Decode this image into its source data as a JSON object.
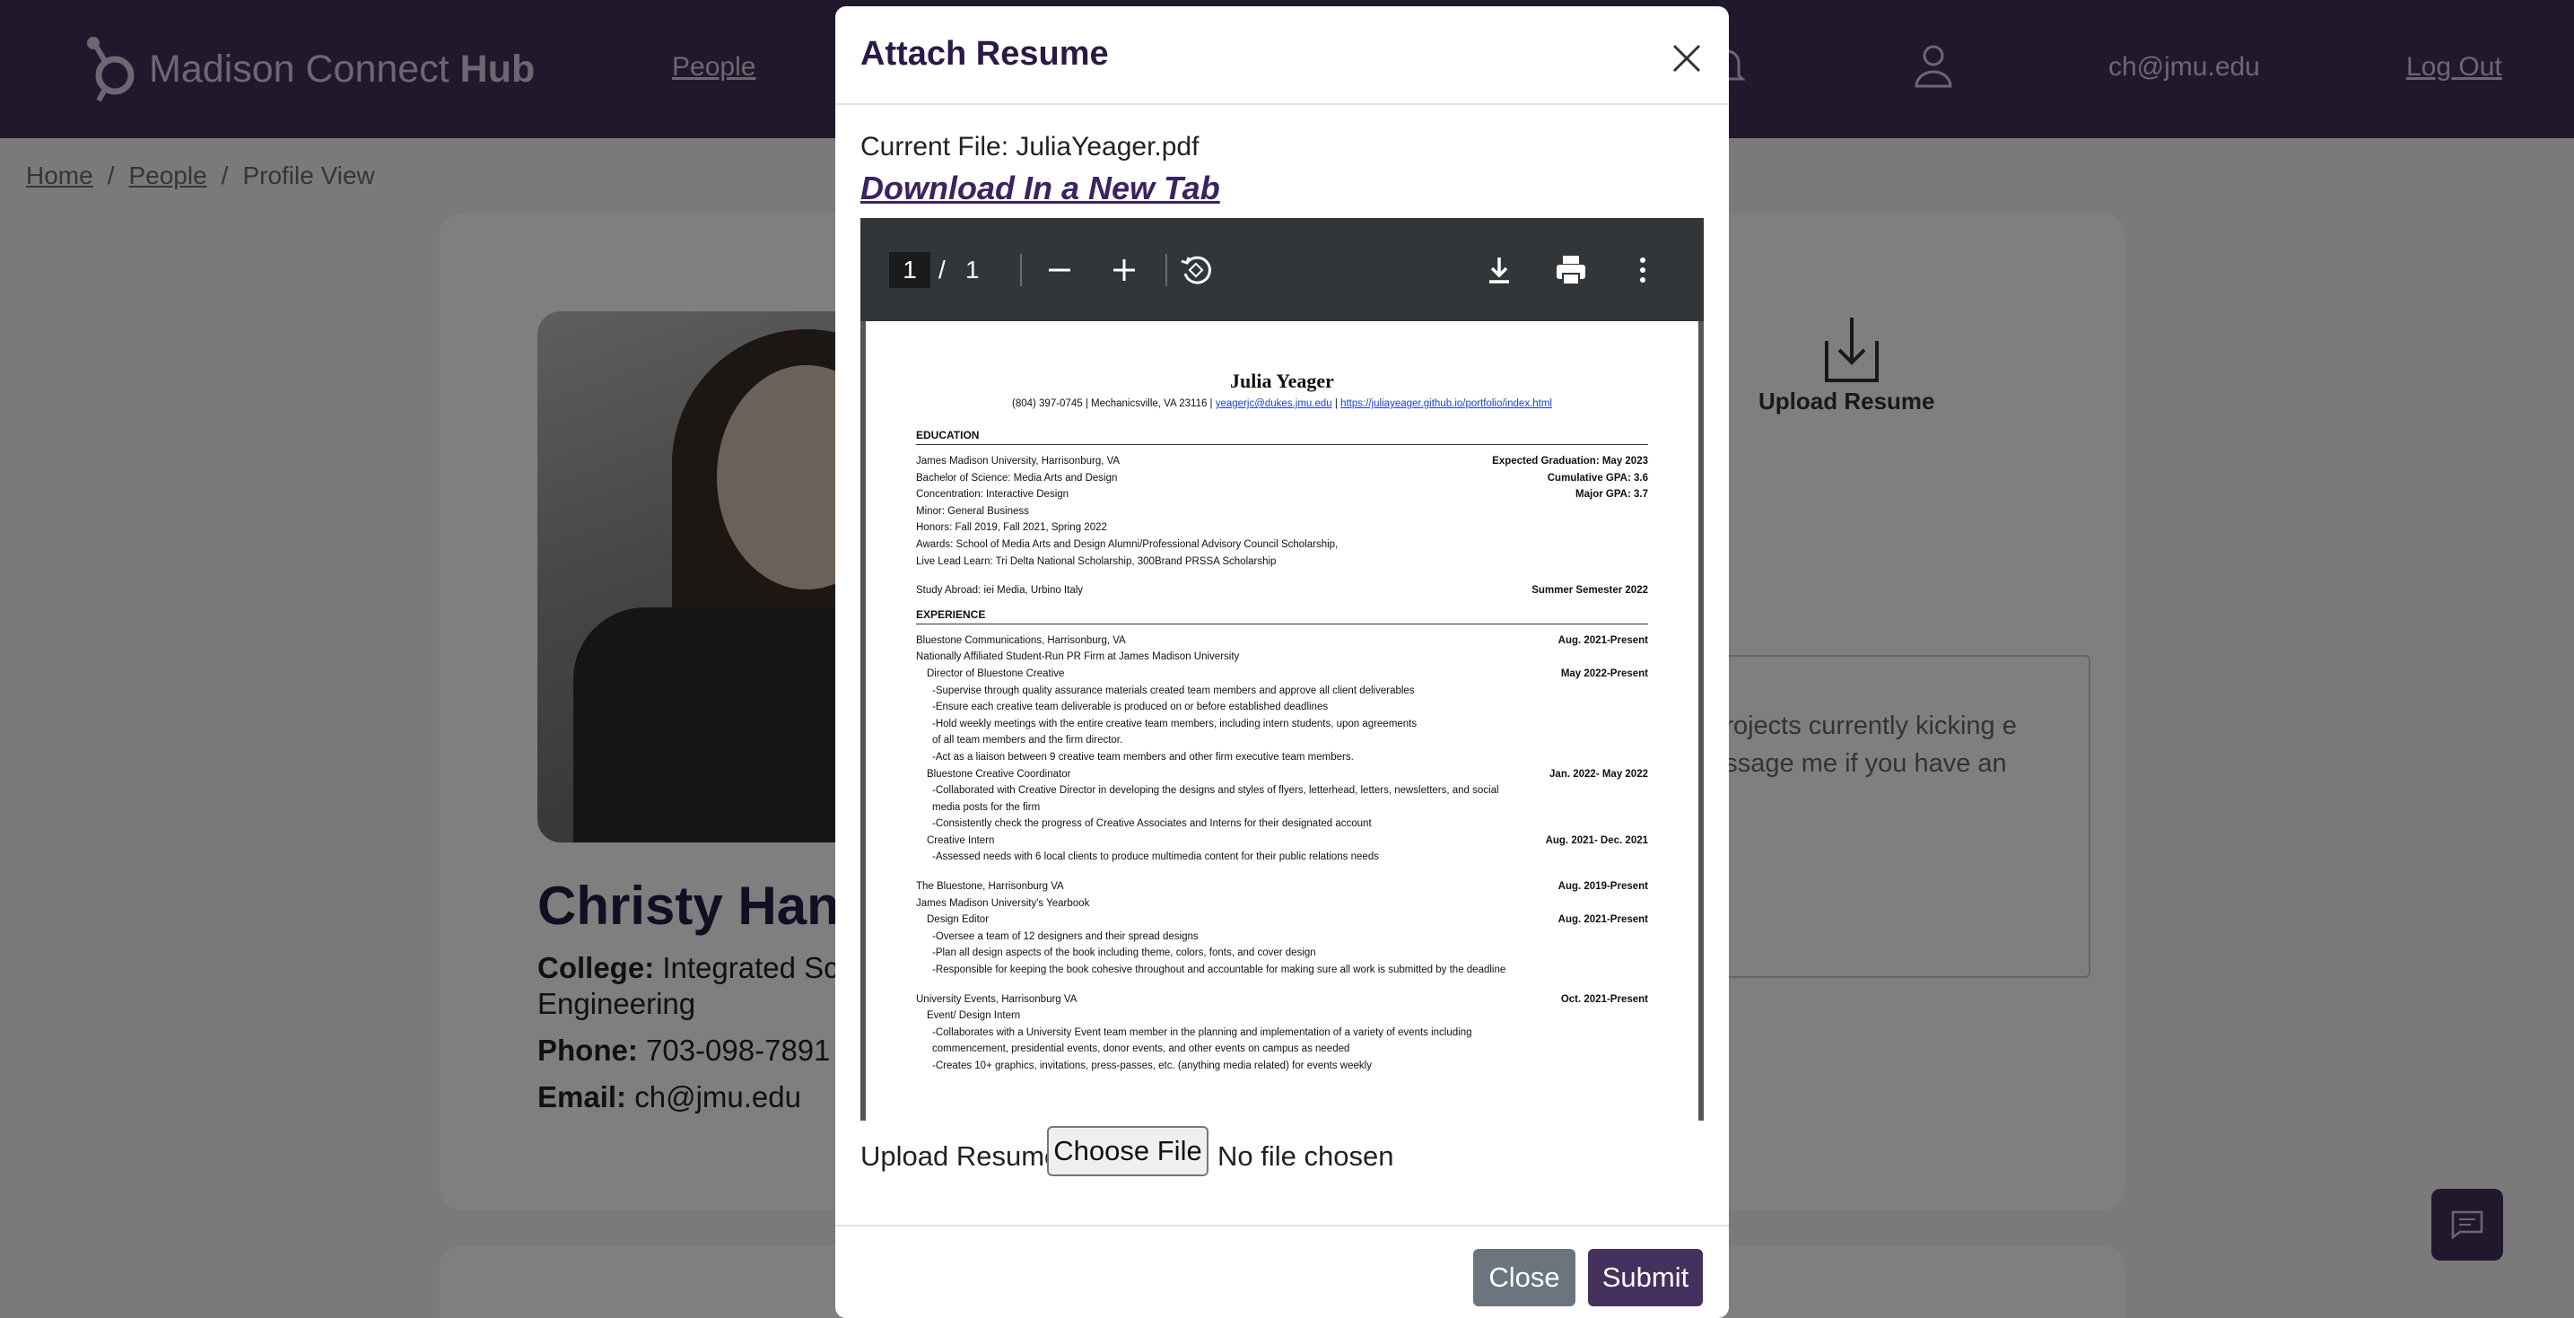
{
  "navbar": {
    "brand_light": "Madison Connect",
    "brand_bold": "Hub",
    "people_link": "People",
    "email": "ch@jmu.edu",
    "logout": "Log Out"
  },
  "breadcrumb": {
    "home": "Home",
    "sep1": "/",
    "people": "People",
    "sep2": "/",
    "current": "Profile View"
  },
  "profile": {
    "name": "Christy Hans",
    "college_label": "College:",
    "college_value": "Integrated Sci",
    "college_value_2": "Engineering",
    "phone_label": "Phone:",
    "phone_value": "703-098-7891",
    "email_label": "Email:",
    "email_value": "ch@jmu.edu"
  },
  "upload_card": {
    "label": "Upload Resume"
  },
  "bio": {
    "text": "e projects currently kicking e message me if you have an"
  },
  "modal": {
    "title": "Attach Resume",
    "current_file": "Current File: JuliaYeager.pdf",
    "download_link": "Download In a New Tab",
    "upload_label": "Upload Resume",
    "choose_file": "Choose File",
    "no_file": "No file chosen",
    "close_button": "Close",
    "submit_button": "Submit"
  },
  "pdf": {
    "current_page": "1",
    "separator": "/",
    "total_pages": "1",
    "resume": {
      "name": "Julia Yeager",
      "contact_prefix": "(804) 397-0745 | Mechanicsville, VA 23116 |",
      "contact_email": "yeagerjc@dukes.jmu.edu",
      "contact_sep": "|",
      "contact_url": "https://juliayeager.github.io/portfolio/index.html",
      "education_heading": "EDUCATION",
      "education_rows": [
        {
          "left": "James Madison University, Harrisonburg, VA",
          "right": "Expected Graduation: May 2023"
        },
        {
          "left": "Bachelor of Science: Media Arts and Design",
          "right": "Cumulative GPA: 3.6"
        },
        {
          "left": "Concentration: Interactive Design",
          "right": "Major GPA: 3.7"
        },
        {
          "left": "Minor: General Business",
          "right": ""
        },
        {
          "left": "Honors: Fall 2019, Fall 2021, Spring 2022",
          "right": ""
        },
        {
          "left": "Awards: School of Media Arts and Design Alumni/Professional Advisory Council Scholarship,",
          "right": ""
        },
        {
          "left": "Live Lead Learn: Tri Delta National Scholarship, 300Brand PRSSA Scholarship",
          "right": ""
        }
      ],
      "study_abroad": {
        "left": "Study Abroad: iei Media, Urbino Italy",
        "right": "Summer Semester 2022"
      },
      "experience_heading": "EXPERIENCE",
      "experience_rows": [
        {
          "left": "Bluestone Communications, Harrisonburg, VA",
          "right": "Aug. 2021-Present",
          "ind": 0
        },
        {
          "left": "Nationally Affiliated Student-Run PR Firm at James Madison University",
          "right": "",
          "ind": 0
        },
        {
          "left": "Director of Bluestone Creative",
          "right": "May 2022-Present",
          "ind": 1
        },
        {
          "left": "-Supervise through quality assurance materials created team members and approve all client deliverables",
          "right": "",
          "ind": 2
        },
        {
          "left": "-Ensure each creative team deliverable is produced on or before established deadlines",
          "right": "",
          "ind": 2
        },
        {
          "left": "-Hold weekly meetings with the entire creative team members, including intern students, upon agreements",
          "right": "",
          "ind": 2
        },
        {
          "left": "of all team members and the firm director.",
          "right": "",
          "ind": 2
        },
        {
          "left": "-Act as a liaison between 9 creative team members and other firm executive team members.",
          "right": "",
          "ind": 2
        },
        {
          "left": "Bluestone Creative Coordinator",
          "right": "Jan. 2022- May 2022",
          "ind": 1
        },
        {
          "left": "-Collaborated with Creative Director in developing the designs and styles of flyers, letterhead, letters, newsletters, and social",
          "right": "",
          "ind": 2
        },
        {
          "left": "media posts for the firm",
          "right": "",
          "ind": 2
        },
        {
          "left": "-Consistently check the progress of Creative Associates and Interns for their designated account",
          "right": "",
          "ind": 2
        },
        {
          "left": "Creative Intern",
          "right": "Aug. 2021- Dec. 2021",
          "ind": 1
        },
        {
          "left": "-Assessed needs with 6 local clients to produce multimedia content for their public relations needs",
          "right": "",
          "ind": 2
        },
        {
          "left": "",
          "right": "",
          "ind": 0
        },
        {
          "left": "The Bluestone, Harrisonburg VA",
          "right": "Aug. 2019-Present",
          "ind": 0
        },
        {
          "left": "James Madison University's Yearbook",
          "right": "",
          "ind": 0
        },
        {
          "left": "Design Editor",
          "right": "Aug. 2021-Present",
          "ind": 1
        },
        {
          "left": "-Oversee a team of 12 designers and their spread designs",
          "right": "",
          "ind": 2
        },
        {
          "left": "-Plan all design aspects of the book including theme, colors, fonts, and cover design",
          "right": "",
          "ind": 2
        },
        {
          "left": "-Responsible for keeping the book cohesive throughout and accountable for making sure all work is submitted by the deadline",
          "right": "",
          "ind": 2
        },
        {
          "left": "",
          "right": "",
          "ind": 0
        },
        {
          "left": "University Events, Harrisonburg VA",
          "right": "Oct. 2021-Present",
          "ind": 0
        },
        {
          "left": "Event/ Design Intern",
          "right": "",
          "ind": 1
        },
        {
          "left": "-Collaborates with a University Event team member in the planning and implementation of a variety of events including",
          "right": "",
          "ind": 2
        },
        {
          "left": "commencement, presidential events, donor events, and other events on campus as needed",
          "right": "",
          "ind": 2
        },
        {
          "left": "-Creates 10+ graphics, invitations, press-passes, etc. (anything media related) for events weekly",
          "right": "",
          "ind": 2
        }
      ]
    }
  },
  "colors": {
    "brand_purple": "#45315d",
    "title_purple": "#2b1a45",
    "close_gray": "#6c757d",
    "pdf_toolbar": "#323639"
  }
}
